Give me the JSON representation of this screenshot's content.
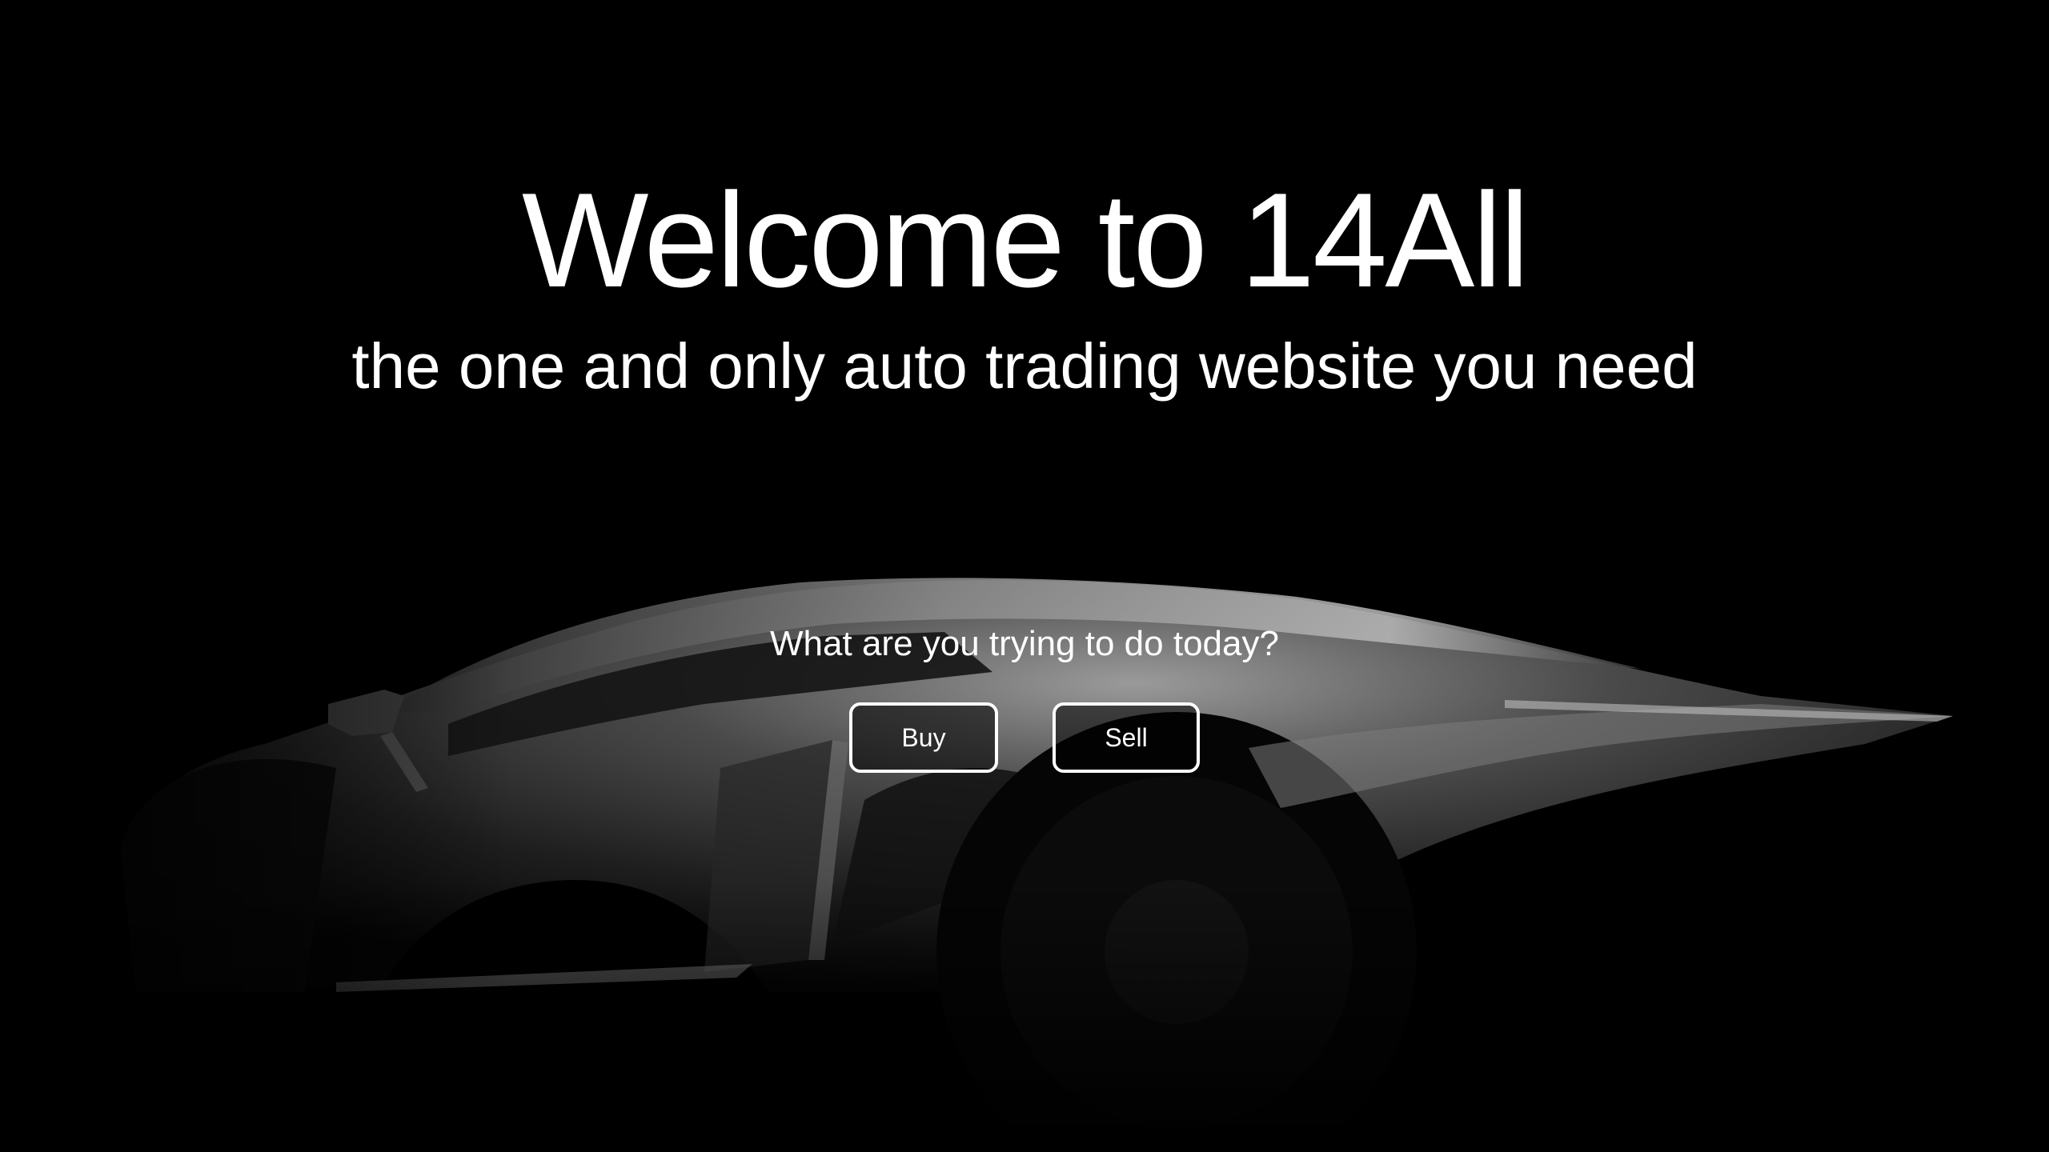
{
  "hero": {
    "title": "Welcome to 14All",
    "subtitle": "the one and only auto trading website you need",
    "background_image": "car-silhouette"
  },
  "cta": {
    "prompt": "What are you trying to do today?",
    "buy_label": "Buy",
    "sell_label": "Sell"
  },
  "colors": {
    "background": "#000000",
    "text": "#ffffff",
    "button_border": "#ffffff"
  }
}
